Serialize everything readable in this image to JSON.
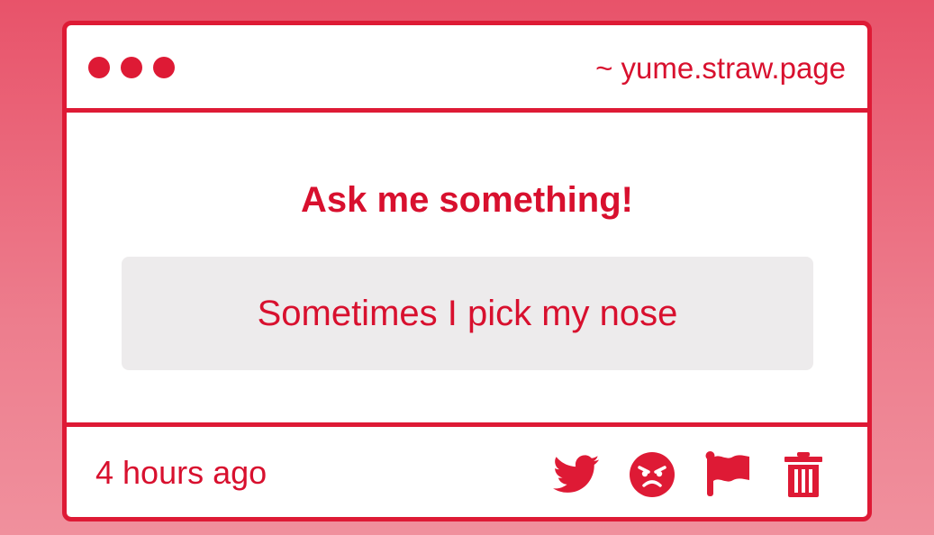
{
  "window": {
    "host": "~ yume.straw.page",
    "controls": [
      "dot",
      "dot",
      "dot"
    ]
  },
  "main": {
    "heading": "Ask me something!",
    "question": "Sometimes I pick my nose"
  },
  "footer": {
    "time": "4 hours ago",
    "actions": [
      {
        "icon": "twitter-icon"
      },
      {
        "icon": "angry-face-icon"
      },
      {
        "icon": "flag-icon"
      },
      {
        "icon": "trash-icon"
      }
    ]
  },
  "colors": {
    "accent": "#de1a35",
    "question_bg": "#edebec",
    "background_top": "#e8536a",
    "background_bottom": "#f0909d"
  }
}
